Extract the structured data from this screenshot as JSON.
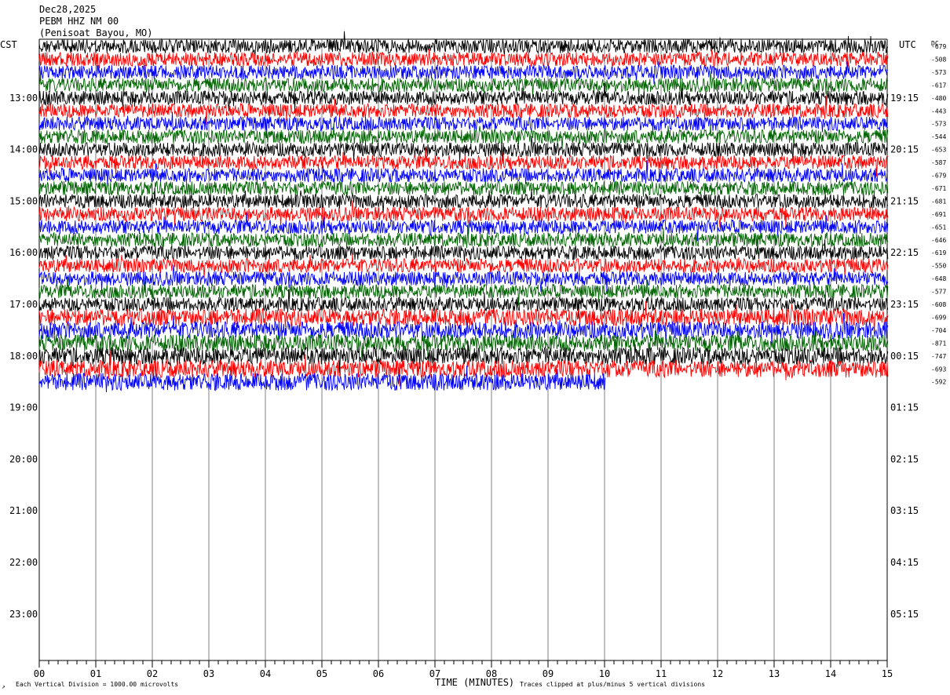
{
  "header": {
    "date": "Dec28,2025",
    "station": "PEBM HHZ NM 00",
    "location": "(Penisoat Bayou, MO)"
  },
  "labels": {
    "left_timezone": "CST",
    "right_timezone": "UTC",
    "dc_header": "DC",
    "x_axis_title": "TIME (MINUTES)",
    "scale_note": "Each Vertical Division = 1000.00 microvolts",
    "clip_note": "Traces clipped at plus/minus 5 vertical divisions"
  },
  "colors": {
    "trace_cycle": [
      "#000000",
      "#ff0000",
      "#0000ff",
      "#006400"
    ],
    "grid": "#808080",
    "axis": "#000000"
  },
  "chart_data": {
    "type": "line",
    "title": "PEBM HHZ NM 00",
    "xlabel": "TIME (MINUTES)",
    "x_ticks": [
      "00",
      "01",
      "02",
      "03",
      "04",
      "05",
      "06",
      "07",
      "08",
      "09",
      "10",
      "11",
      "12",
      "13",
      "14",
      "15"
    ],
    "xlim": [
      0,
      15
    ],
    "left_time_labels": [
      "13:00",
      "14:00",
      "15:00",
      "16:00",
      "17:00",
      "18:00",
      "19:00",
      "20:00",
      "21:00",
      "22:00",
      "23:00"
    ],
    "right_time_labels": [
      "19:15",
      "20:15",
      "21:15",
      "22:15",
      "23:15",
      "00:15",
      "01:15",
      "02:15",
      "03:15",
      "04:15",
      "05:15"
    ],
    "total_rows": 48,
    "rows_per_hour": 4,
    "first_row_clock": "12:00",
    "dc_offsets": [
      -679,
      -508,
      -573,
      -617,
      -480,
      -443,
      -573,
      -544,
      -653,
      -587,
      -679,
      -671,
      -681,
      -691,
      -651,
      -646,
      -619,
      -550,
      -648,
      -577,
      -608,
      -699,
      -704,
      -871,
      -747,
      -693,
      -592
    ],
    "filled_rows": 27,
    "last_row_end_minute": 10.0
  }
}
